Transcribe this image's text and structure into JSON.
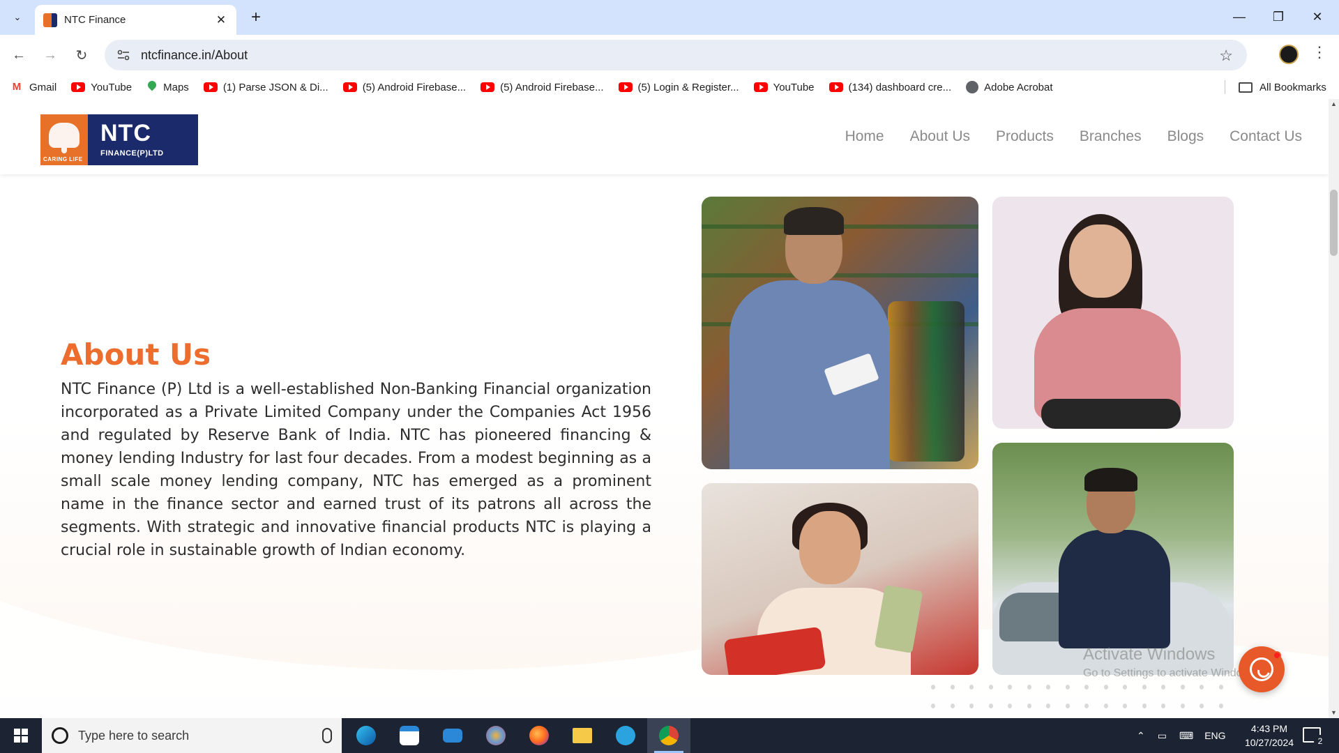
{
  "browser": {
    "tab_title": "NTC Finance",
    "tab_close_glyph": "✕",
    "new_tab_glyph": "+",
    "url": "ntcfinance.in/About",
    "window_controls": {
      "minimize": "—",
      "restore": "❐",
      "close": "✕"
    },
    "nav_glyphs": {
      "back": "←",
      "forward": "→",
      "reload": "↻",
      "star": "☆",
      "menu": "⋮",
      "tab_search": "⌄"
    },
    "bookmarks": [
      {
        "label": "Gmail",
        "icon": "gmail-icon"
      },
      {
        "label": "YouTube",
        "icon": "youtube-icon"
      },
      {
        "label": "Maps",
        "icon": "maps-icon"
      },
      {
        "label": "(1) Parse JSON & Di...",
        "icon": "youtube-icon"
      },
      {
        "label": "(5) Android Firebase...",
        "icon": "youtube-icon"
      },
      {
        "label": "(5) Android Firebase...",
        "icon": "youtube-icon"
      },
      {
        "label": "(5) Login & Register...",
        "icon": "youtube-icon"
      },
      {
        "label": "YouTube",
        "icon": "youtube-icon"
      },
      {
        "label": "(134) dashboard cre...",
        "icon": "youtube-icon"
      },
      {
        "label": "Adobe Acrobat",
        "icon": "acrobat-icon"
      }
    ],
    "all_bookmarks": "All Bookmarks"
  },
  "site": {
    "logo": {
      "name": "NTC",
      "sub": "FINANCE(P)LTD",
      "tagline": "CARING LIFE"
    },
    "nav": [
      "Home",
      "About Us",
      "Products",
      "Branches",
      "Blogs",
      "Contact Us"
    ],
    "about": {
      "title": "About Us",
      "body": "NTC Finance (P) Ltd is a well-established Non-Banking Financial organization incorporated as a Private Limited Company under the Companies Act 1956 and regulated by Reserve Bank of India. NTC has pioneered financing & money lending Industry for last four decades. From a modest beginning as a small scale money lending company, NTC has emerged as a prominent name in the finance sector and earned trust of its patrons all across the segments. With strategic and innovative financial products NTC is playing a crucial role in sustainable growth of Indian economy."
    },
    "overlay": {
      "activate_title": "Activate Windows",
      "activate_sub": "Go to Settings to activate Windows."
    }
  },
  "taskbar": {
    "search_placeholder": "Type here to search",
    "apps": [
      "edge-icon",
      "store-icon",
      "mail-icon",
      "paint-icon",
      "firefox-icon",
      "file-explorer-icon",
      "telegram-icon",
      "chrome-icon"
    ],
    "language": "ENG",
    "time": "4:43 PM",
    "date": "10/27/2024",
    "notification_count": "2",
    "tray_glyphs": {
      "chevron": "⌃",
      "battery": "▭",
      "keyboard": "⌨"
    }
  },
  "colors": {
    "brand_orange": "#ec6d2d",
    "brand_navy": "#1b2a6b",
    "nav_text": "#8a8a8a",
    "whatsapp_button": "#e8592a"
  }
}
